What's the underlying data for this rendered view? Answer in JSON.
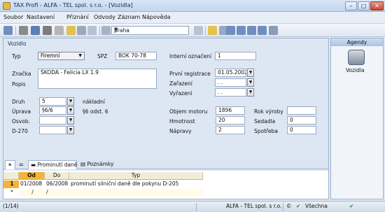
{
  "window": {
    "title": "TAX Profi - ALFA - TEL spol. s r.o. - [Vozidla]"
  },
  "menu": [
    "Soubor",
    "Nastavení",
    "Přiznání",
    "Odvody",
    "Záznam",
    "Nápověda"
  ],
  "toolbar": {
    "combo_value": "praha"
  },
  "section_title": "Vozidlo",
  "form": {
    "typ_label": "Typ",
    "typ_value": "Firemní",
    "spz_label": "SPZ",
    "spz_value": "BOK 70-78",
    "interni_label": "Interní označení",
    "interni_value": "1",
    "znacka_label": "Značka",
    "znacka_value": "ŠKODA - Felicia LX 1.9",
    "popis_label": "Popis",
    "prvni_reg_label": "První registrace",
    "prvni_reg_value": "01.05.2002",
    "zarazeni_label": "Zařazení",
    "zarazeni_value": " .  .",
    "vyrazeni_label": "Vyřazení",
    "vyrazeni_value": " .  .",
    "druh_label": "Druh",
    "druh_value": "5",
    "druh_text": "nákladní",
    "uprava_label": "Úprava",
    "uprava_value": "§6/6",
    "uprava_text": "§6 odst. 6",
    "osvob_label": "Osvob.",
    "d270_label": "D-270",
    "objem_label": "Objem motoru",
    "objem_value": "1896",
    "hmotnost_label": "Hmotnost",
    "hmotnost_value": "20",
    "napravy_label": "Nápravy",
    "napravy_value": "2",
    "rok_label": "Rok výroby",
    "sedadla_label": "Sedadla",
    "sedadla_value": "0",
    "spotreba_label": "Spotřeba",
    "spotreba_value": "0"
  },
  "tabs": [
    "Prominutí daně",
    "Poznámky"
  ],
  "grid": {
    "headers": [
      "Od",
      "Do",
      "Typ"
    ],
    "rows": [
      {
        "num": "1",
        "od": "01/2008",
        "do": "06/2008",
        "typ": "prominutí silniční daně dle pokynu D-205"
      },
      {
        "num": "*",
        "od": "/",
        "do": "/",
        "typ": ""
      }
    ]
  },
  "sidebar": {
    "header": "Agendy",
    "item": "Vozidla"
  },
  "status": {
    "count": "(1/14)",
    "company": "ALFA - TEL spol. s r.o.",
    "filter": "Všechna"
  }
}
